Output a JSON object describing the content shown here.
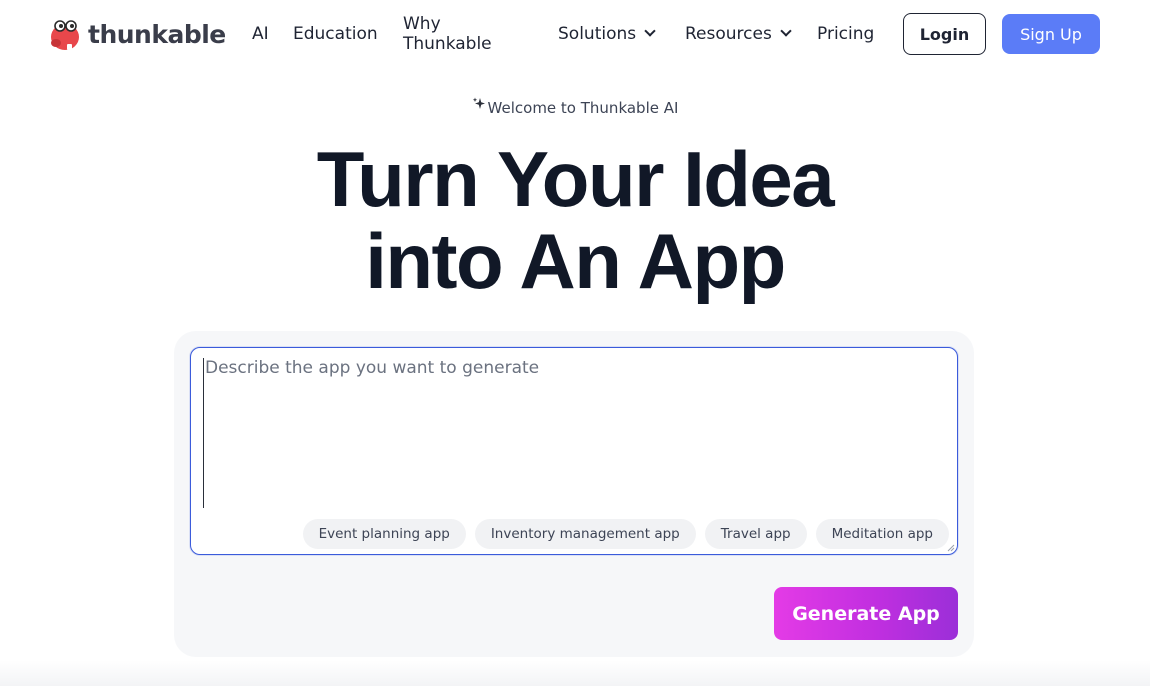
{
  "brand": {
    "name": "thunkable",
    "logo_icon": "thunkable-mascot-icon",
    "logo_color": "#e8474b"
  },
  "nav": {
    "ai": "AI",
    "education": "Education",
    "why_line1": "Why",
    "why_line2": "Thunkable",
    "solutions": "Solutions",
    "resources": "Resources",
    "pricing": "Pricing",
    "login": "Login",
    "signup": "Sign Up"
  },
  "hero": {
    "welcome": "Welcome to Thunkable AI",
    "sparkle_icon": "sparkle-icon",
    "headline_line1": "Turn Your Idea",
    "headline_line2": "into An App"
  },
  "generator": {
    "placeholder": "Describe the app you want to generate",
    "value": "",
    "suggestions": [
      "Event planning app",
      "Inventory management app",
      "Travel app",
      "Meditation app"
    ],
    "button": "Generate App"
  },
  "colors": {
    "accent_blue": "#5b7cf7",
    "input_border": "#3b5bdb",
    "generate_gradient_start": "#e43be6",
    "generate_gradient_end": "#9b2fd8",
    "card_bg": "#f6f7f9"
  }
}
